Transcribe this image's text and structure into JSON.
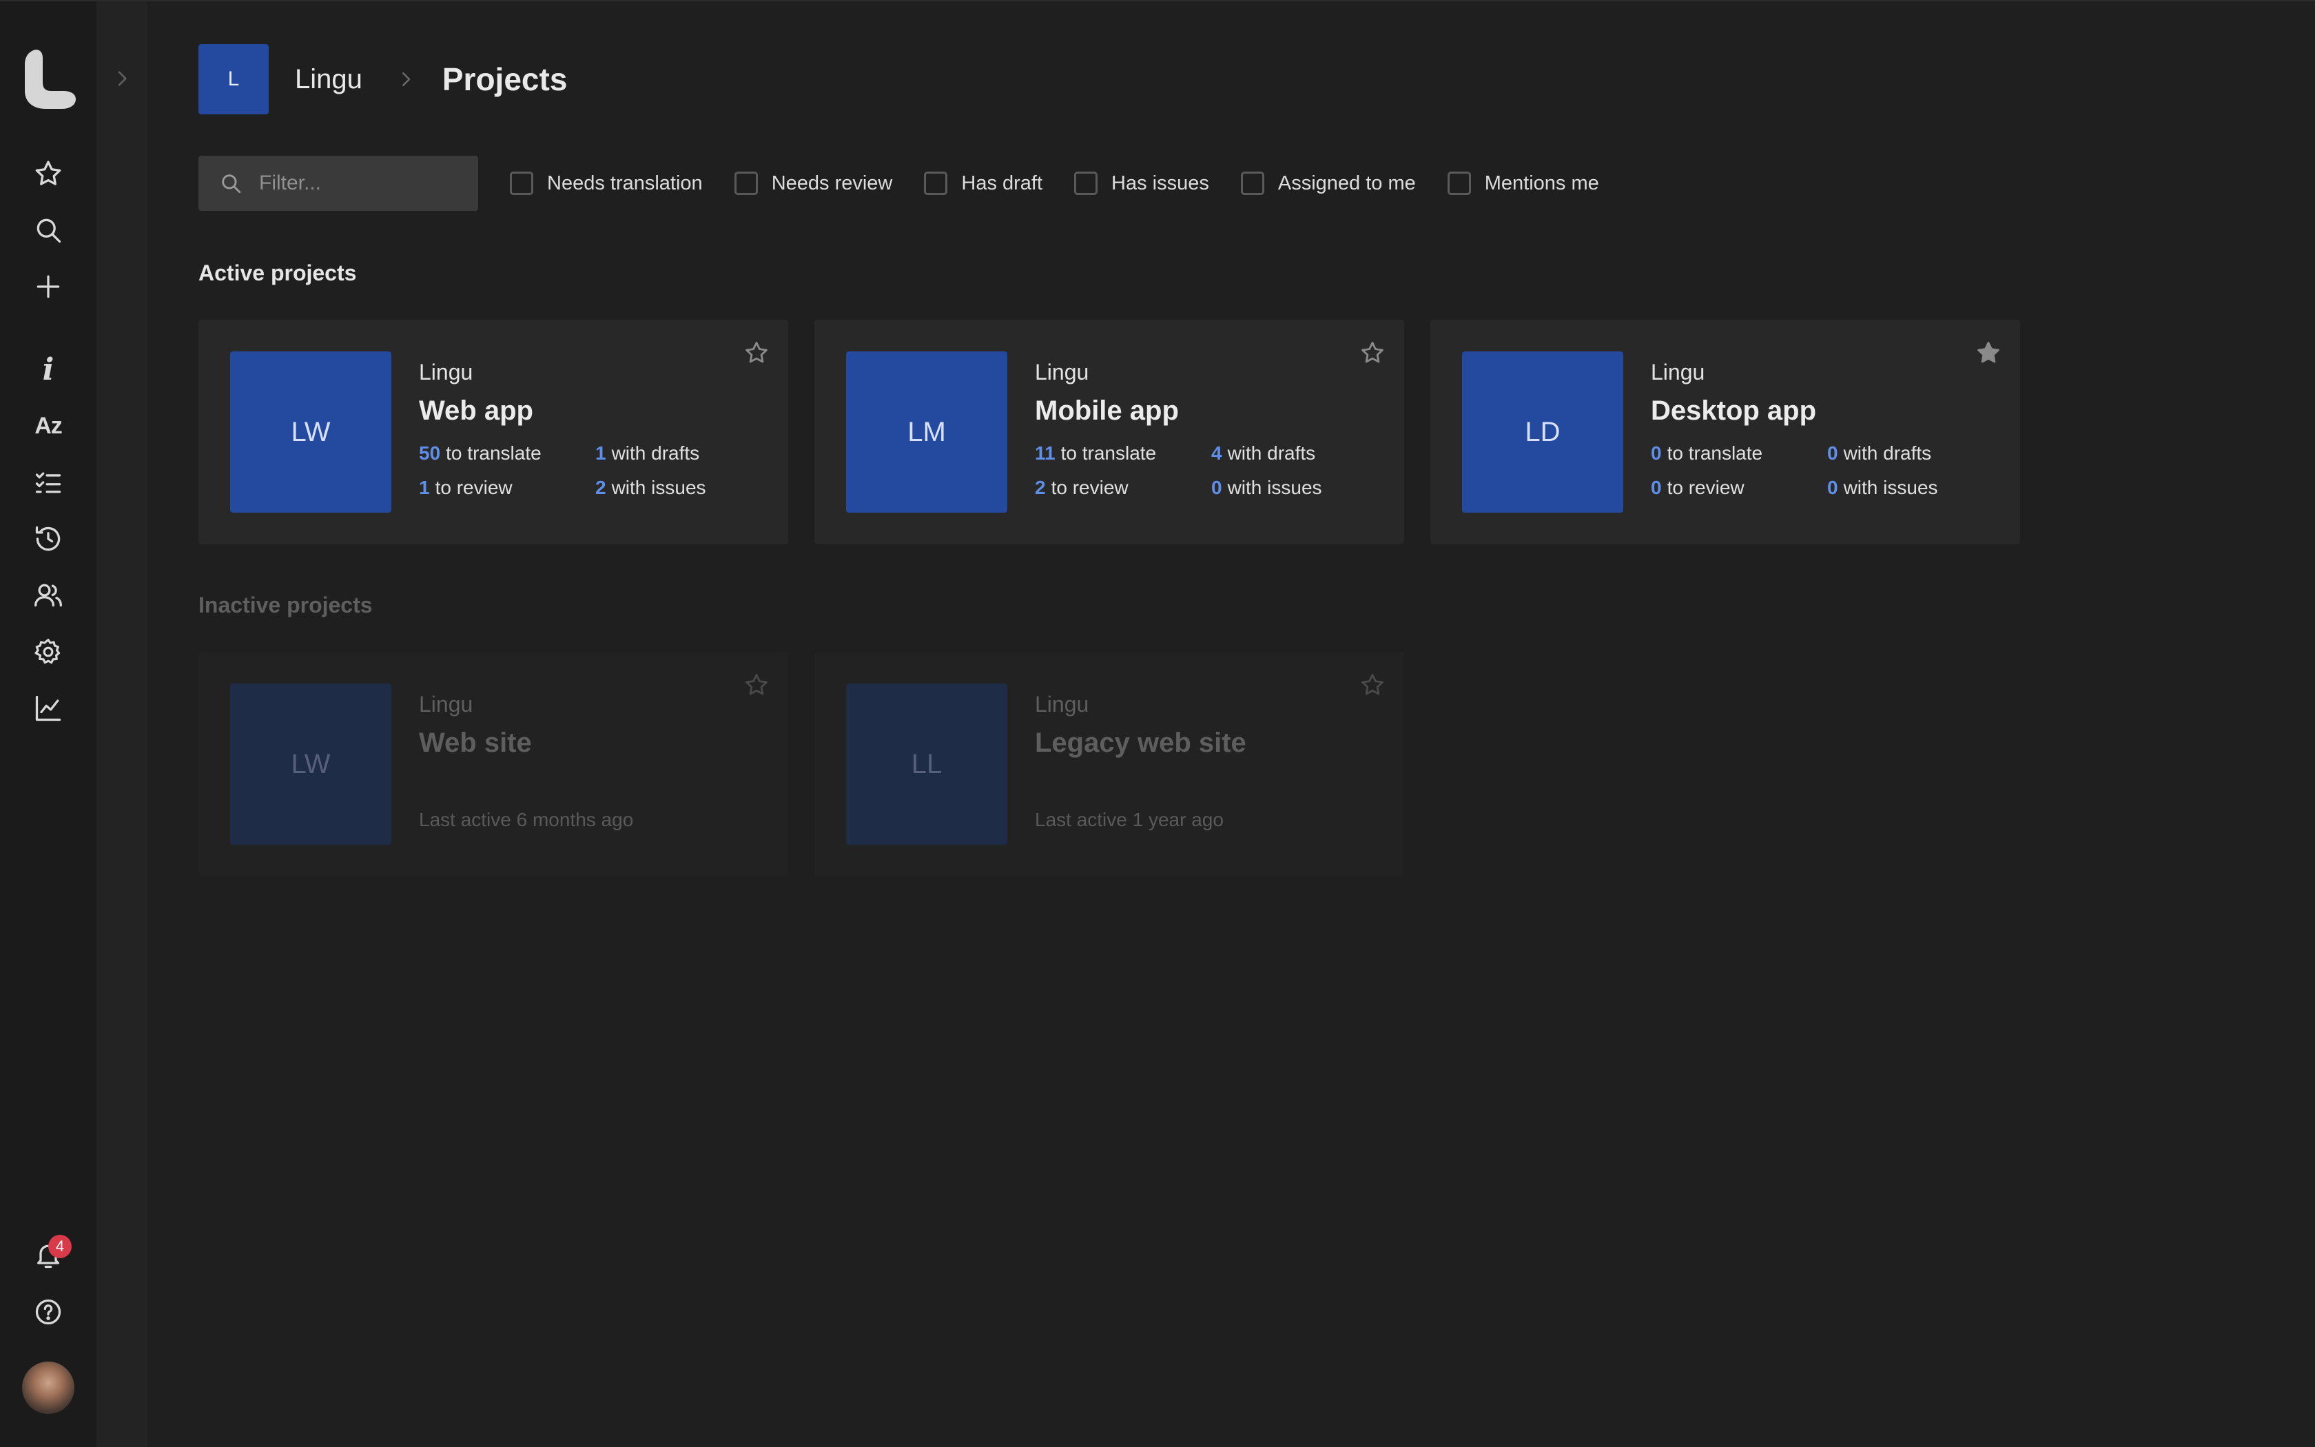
{
  "header": {
    "org_initial": "L",
    "org_name": "Lingu",
    "page_title": "Projects"
  },
  "filters": {
    "search_placeholder": "Filter...",
    "search_value": "",
    "options": [
      {
        "label": "Needs translation",
        "checked": false
      },
      {
        "label": "Needs review",
        "checked": false
      },
      {
        "label": "Has draft",
        "checked": false
      },
      {
        "label": "Has issues",
        "checked": false
      },
      {
        "label": "Assigned to me",
        "checked": false
      },
      {
        "label": "Mentions me",
        "checked": false
      }
    ]
  },
  "sidebar": {
    "icons": [
      "star-icon",
      "search-icon",
      "plus-icon",
      "info-icon",
      "az-icon",
      "checklist-icon",
      "history-icon",
      "users-icon",
      "gear-icon",
      "chart-icon"
    ],
    "info_glyph": "i",
    "az_glyph": "Az",
    "notifications_count": "4"
  },
  "sections": {
    "active_title": "Active projects",
    "inactive_title": "Inactive projects"
  },
  "active_projects": [
    {
      "initials": "LW",
      "org": "Lingu",
      "name": "Web app",
      "starred": false,
      "to_translate": "50",
      "to_translate_label": "to translate",
      "to_review": "1",
      "to_review_label": "to review",
      "with_drafts": "1",
      "with_drafts_label": "with drafts",
      "with_issues": "2",
      "with_issues_label": "with issues"
    },
    {
      "initials": "LM",
      "org": "Lingu",
      "name": "Mobile app",
      "starred": false,
      "to_translate": "11",
      "to_translate_label": "to translate",
      "to_review": "2",
      "to_review_label": "to review",
      "with_drafts": "4",
      "with_drafts_label": "with drafts",
      "with_issues": "0",
      "with_issues_label": "with issues"
    },
    {
      "initials": "LD",
      "org": "Lingu",
      "name": "Desktop app",
      "starred": true,
      "to_translate": "0",
      "to_translate_label": "to translate",
      "to_review": "0",
      "to_review_label": "to review",
      "with_drafts": "0",
      "with_drafts_label": "with drafts",
      "with_issues": "0",
      "with_issues_label": "with issues"
    }
  ],
  "inactive_projects": [
    {
      "initials": "LW",
      "org": "Lingu",
      "name": "Web site",
      "starred": false,
      "last_active": "Last active 6 months ago"
    },
    {
      "initials": "LL",
      "org": "Lingu",
      "name": "Legacy web site",
      "starred": false,
      "last_active": "Last active 1 year ago"
    }
  ],
  "colors": {
    "background": "#1f1f1f",
    "rail": "#1b1b1b",
    "card": "#282828",
    "tile": "#234a9e",
    "accent_number": "#5f8fe8",
    "badge": "#d93a4a"
  }
}
